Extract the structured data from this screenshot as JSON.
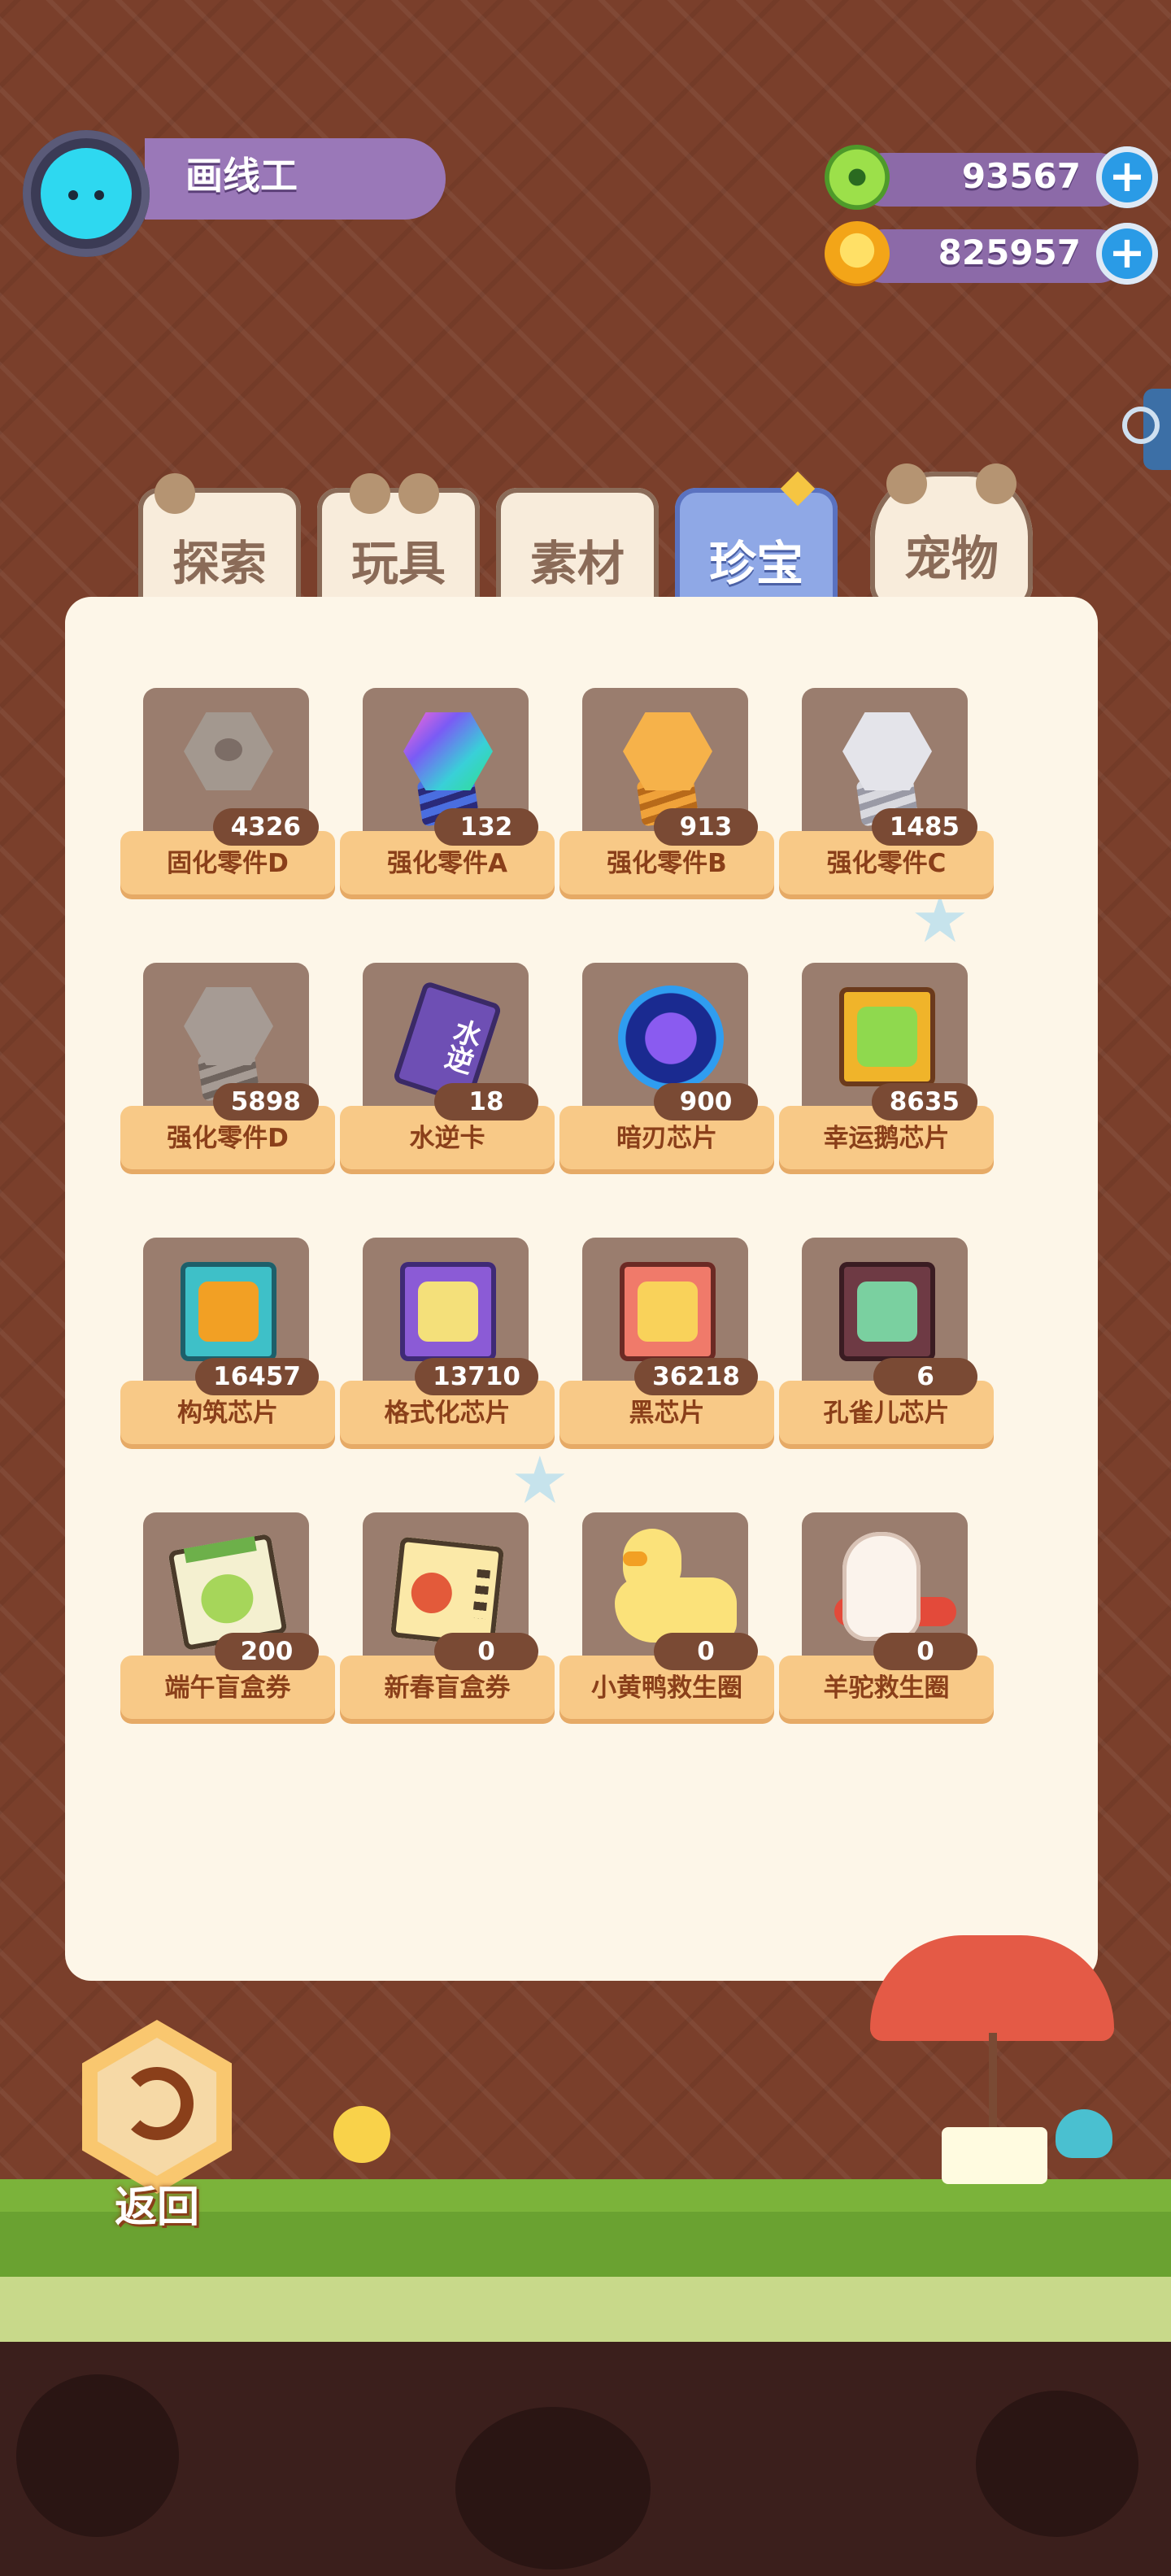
{
  "player": {
    "name": "画线工"
  },
  "currencies": [
    {
      "value": "93567",
      "icon": "green-token-icon",
      "color": "#6cc13b"
    },
    {
      "value": "825957",
      "icon": "gold-coin-icon",
      "color": "#f3a518"
    }
  ],
  "tabs": [
    {
      "label": "探索",
      "active": false
    },
    {
      "label": "玩具",
      "active": false
    },
    {
      "label": "素材",
      "active": false
    },
    {
      "label": "珍宝",
      "active": true
    },
    {
      "label": "宠物",
      "active": false
    }
  ],
  "items": [
    {
      "name": "固化零件D",
      "count": "4326",
      "icon": "gray-nut-icon"
    },
    {
      "name": "强化零件A",
      "count": "132",
      "icon": "rainbow-bolt-icon"
    },
    {
      "name": "强化零件B",
      "count": "913",
      "icon": "gold-bolt-icon"
    },
    {
      "name": "强化零件C",
      "count": "1485",
      "icon": "silver-bolt-icon"
    },
    {
      "name": "强化零件D",
      "count": "5898",
      "icon": "gray-bolt-icon"
    },
    {
      "name": "水逆卡",
      "count": "18",
      "icon": "purple-card-icon",
      "card_text": "水逆"
    },
    {
      "name": "暗刃芯片",
      "count": "900",
      "icon": "dark-blade-chip-icon"
    },
    {
      "name": "幸运鹅芯片",
      "count": "8635",
      "icon": "lucky-goose-chip-icon"
    },
    {
      "name": "构筑芯片",
      "count": "16457",
      "icon": "build-chip-icon"
    },
    {
      "name": "格式化芯片",
      "count": "13710",
      "icon": "format-chip-icon"
    },
    {
      "name": "黑芯片",
      "count": "36218",
      "icon": "black-chip-icon"
    },
    {
      "name": "孔雀儿芯片",
      "count": "6",
      "icon": "peacock-chip-icon"
    },
    {
      "name": "端午盲盒券",
      "count": "200",
      "icon": "dragon-boat-ticket-icon"
    },
    {
      "name": "新春盲盒券",
      "count": "0",
      "icon": "spring-ticket-icon"
    },
    {
      "name": "小黄鸭救生圈",
      "count": "0",
      "icon": "yellow-duck-ring-icon"
    },
    {
      "name": "羊驼救生圈",
      "count": "0",
      "icon": "alpaca-ring-icon"
    }
  ],
  "return_button": {
    "label": "返回"
  }
}
